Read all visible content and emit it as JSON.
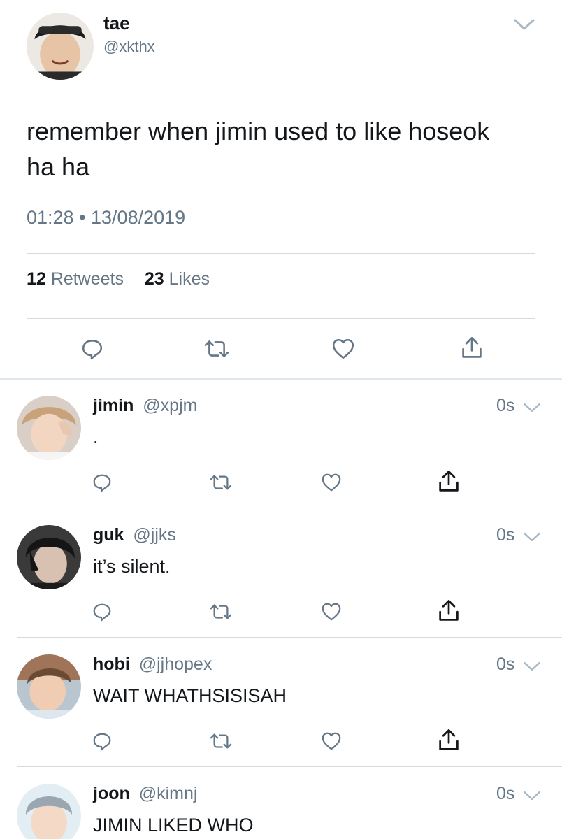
{
  "tweet": {
    "display_name": "tae",
    "handle": "@xkthx",
    "text": "remember when jimin used to like hoseok ha ha",
    "timestamp": "01:28 • 13/08/2019",
    "retweets_count": "12",
    "retweets_label": "Retweets",
    "likes_count": "23",
    "likes_label": "Likes"
  },
  "replies": [
    {
      "display_name": "jimin",
      "handle": "@xpjm",
      "time": "0s",
      "text": "."
    },
    {
      "display_name": "guk",
      "handle": "@jjks",
      "time": "0s",
      "text": "it’s silent."
    },
    {
      "display_name": "hobi",
      "handle": "@jjhopex",
      "time": "0s",
      "text": "WAIT WHATHSISISAH"
    },
    {
      "display_name": "joon",
      "handle": "@kimnj",
      "time": "0s",
      "text": "JIMIN LIKED WHO"
    }
  ],
  "icons": {
    "reply": "reply-icon",
    "retweet": "retweet-icon",
    "like": "heart-icon",
    "share": "share-icon",
    "more": "chevron-down-icon"
  },
  "colors": {
    "text": "#14171a",
    "secondary": "#657786",
    "divider": "#d6dade",
    "background": "#ffffff"
  }
}
